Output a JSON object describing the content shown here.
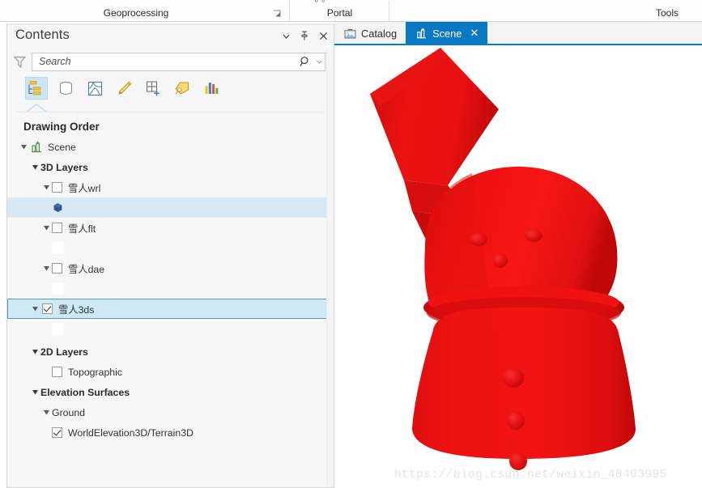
{
  "ribbon": {
    "groups": [
      {
        "label": "Geoprocessing"
      },
      {
        "label": "Portal"
      },
      {
        "label": "Tools"
      }
    ],
    "ghost_text": "y        y"
  },
  "contents_panel": {
    "title": "Contents",
    "window_buttons": [
      {
        "name": "menu-dropdown",
        "icon": "chevron-down-icon",
        "label": "▾"
      },
      {
        "name": "pin",
        "icon": "pin-icon",
        "label": "⚐"
      },
      {
        "name": "close",
        "icon": "close-icon",
        "label": "×"
      }
    ],
    "search": {
      "placeholder": "Search",
      "value": "",
      "filter_icon": "filter-funnel-icon",
      "go_icon": "search-icon",
      "caret_icon": "chevron-down-icon"
    },
    "toolbar": [
      {
        "name": "list-by-drawing-order",
        "icon": "drawing-order-icon",
        "active": true
      },
      {
        "name": "list-by-data-source",
        "icon": "database-cylinder-icon",
        "active": false
      },
      {
        "name": "list-by-selection",
        "icon": "selection-polygon-icon",
        "active": false
      },
      {
        "name": "list-by-editing",
        "icon": "pencil-icon",
        "active": false
      },
      {
        "name": "list-by-snapping",
        "icon": "grid-plus-icon",
        "active": false
      },
      {
        "name": "list-by-labeling",
        "icon": "label-tag-icon",
        "active": false
      },
      {
        "name": "list-by-charts",
        "icon": "bar-chart-icon",
        "active": false
      }
    ],
    "tree_header": "Drawing Order",
    "tree": {
      "scene": {
        "label": "Scene",
        "icon": "scene-icon",
        "expanded": true
      },
      "groups": [
        {
          "label": "3D Layers",
          "expanded": true,
          "layers": [
            {
              "label": "雪人 wrl",
              "name_cn": "雪人wrl",
              "checked": false,
              "expanded": true,
              "symbol": "blue-3d-marker",
              "symbol_color": "#3a5f9e",
              "row_highlighted": true,
              "selected": false
            },
            {
              "label": "雪人 flt",
              "name_cn": "雪人flt",
              "checked": false,
              "expanded": true,
              "symbol": "blank-swatch",
              "symbol_color": "#ffffff",
              "row_highlighted": false,
              "selected": false
            },
            {
              "label": "雪人 dae",
              "name_cn": "雪人dae",
              "checked": false,
              "expanded": true,
              "symbol": "blank-swatch",
              "symbol_color": "#ffffff",
              "row_highlighted": false,
              "selected": false
            },
            {
              "label": "雪人 3ds",
              "name_cn": "雪人3ds",
              "checked": true,
              "expanded": true,
              "symbol": "blank-swatch",
              "symbol_color": "#ffffff",
              "row_highlighted": false,
              "selected": true
            }
          ]
        },
        {
          "label": "2D Layers",
          "expanded": true,
          "layers": [
            {
              "label": "Topographic",
              "name_cn": "Topographic",
              "checked": false,
              "expanded": false,
              "symbol": "none",
              "symbol_color": "",
              "row_highlighted": false,
              "selected": false
            }
          ]
        },
        {
          "label": "Elevation Surfaces",
          "expanded": true,
          "surfaces": [
            {
              "label": "Ground",
              "expanded": true,
              "layers": [
                {
                  "label": "WorldElevation3D/Terrain3D",
                  "checked": true
                }
              ]
            }
          ]
        }
      ]
    }
  },
  "view": {
    "tabs": [
      {
        "label": "Catalog",
        "icon": "catalog-briefcase-icon",
        "active": false,
        "closable": false
      },
      {
        "label": "Scene",
        "icon": "scene-icon",
        "active": true,
        "closable": true,
        "close_label": "✕"
      }
    ],
    "watermark": "https://blog.csdn.net/weixin_40403995",
    "scene": {
      "model": "snowman-3d",
      "fill_color": "#ee1111",
      "shade_dark": "#c00808",
      "shade_mid": "#e01010",
      "highlight": "#fb2a1a",
      "background": "#ffffff"
    }
  },
  "colors": {
    "accent_blue": "#0b78c4",
    "selection_fill": "#cfe8f5",
    "selection_border": "#5a9cb8",
    "row_highlight": "#d8e9f5",
    "panel_bg": "#f7f7f7",
    "model_red": "#ee1111"
  }
}
